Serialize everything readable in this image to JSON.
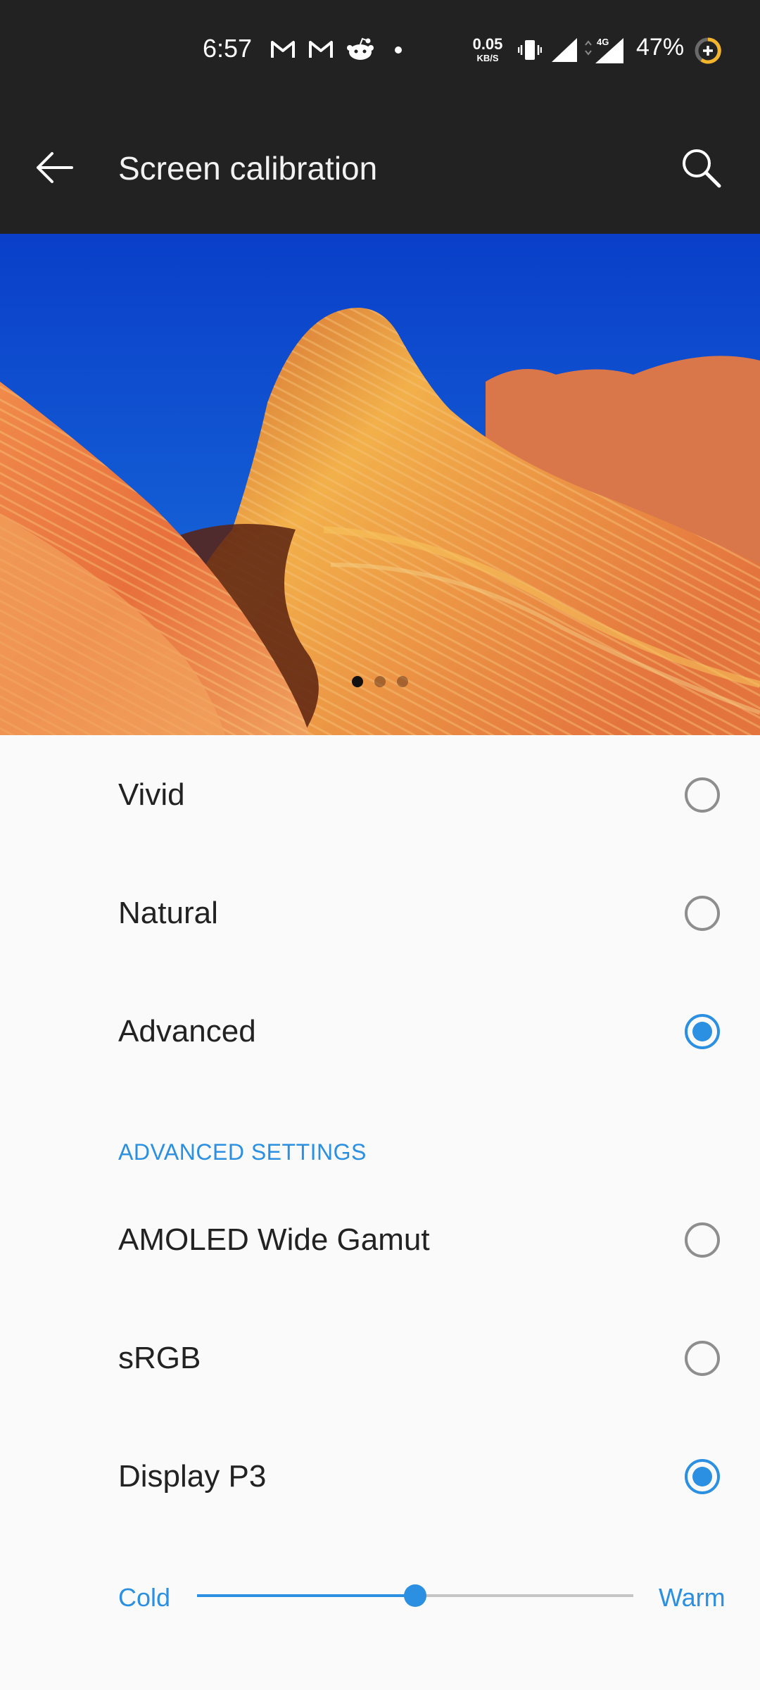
{
  "status_bar": {
    "time": "6:57",
    "net_speed_value": "0.05",
    "net_speed_unit": "KB/S",
    "network_type": "4G",
    "battery": "47%",
    "icons": [
      "gmail-icon",
      "gmail-icon",
      "reddit-icon",
      "dot-icon",
      "vibrate-icon",
      "signal-icon",
      "signal-4g-icon",
      "battery-saver-icon"
    ]
  },
  "app_bar": {
    "title": "Screen calibration",
    "back_icon": "arrow-back-icon",
    "search_icon": "search-icon"
  },
  "preview": {
    "pages": 3,
    "active_page": 1
  },
  "modes": [
    {
      "label": "Vivid",
      "selected": false
    },
    {
      "label": "Natural",
      "selected": false
    },
    {
      "label": "Advanced",
      "selected": true
    }
  ],
  "advanced": {
    "header": "ADVANCED SETTINGS",
    "options": [
      {
        "label": "AMOLED Wide Gamut",
        "selected": false
      },
      {
        "label": "sRGB",
        "selected": false
      },
      {
        "label": "Display P3",
        "selected": true
      }
    ]
  },
  "temperature": {
    "min_label": "Cold",
    "max_label": "Warm",
    "value": 0.5
  },
  "colors": {
    "accent": "#2b8fe2",
    "toolbar": "#222222",
    "background": "#fafafa"
  }
}
